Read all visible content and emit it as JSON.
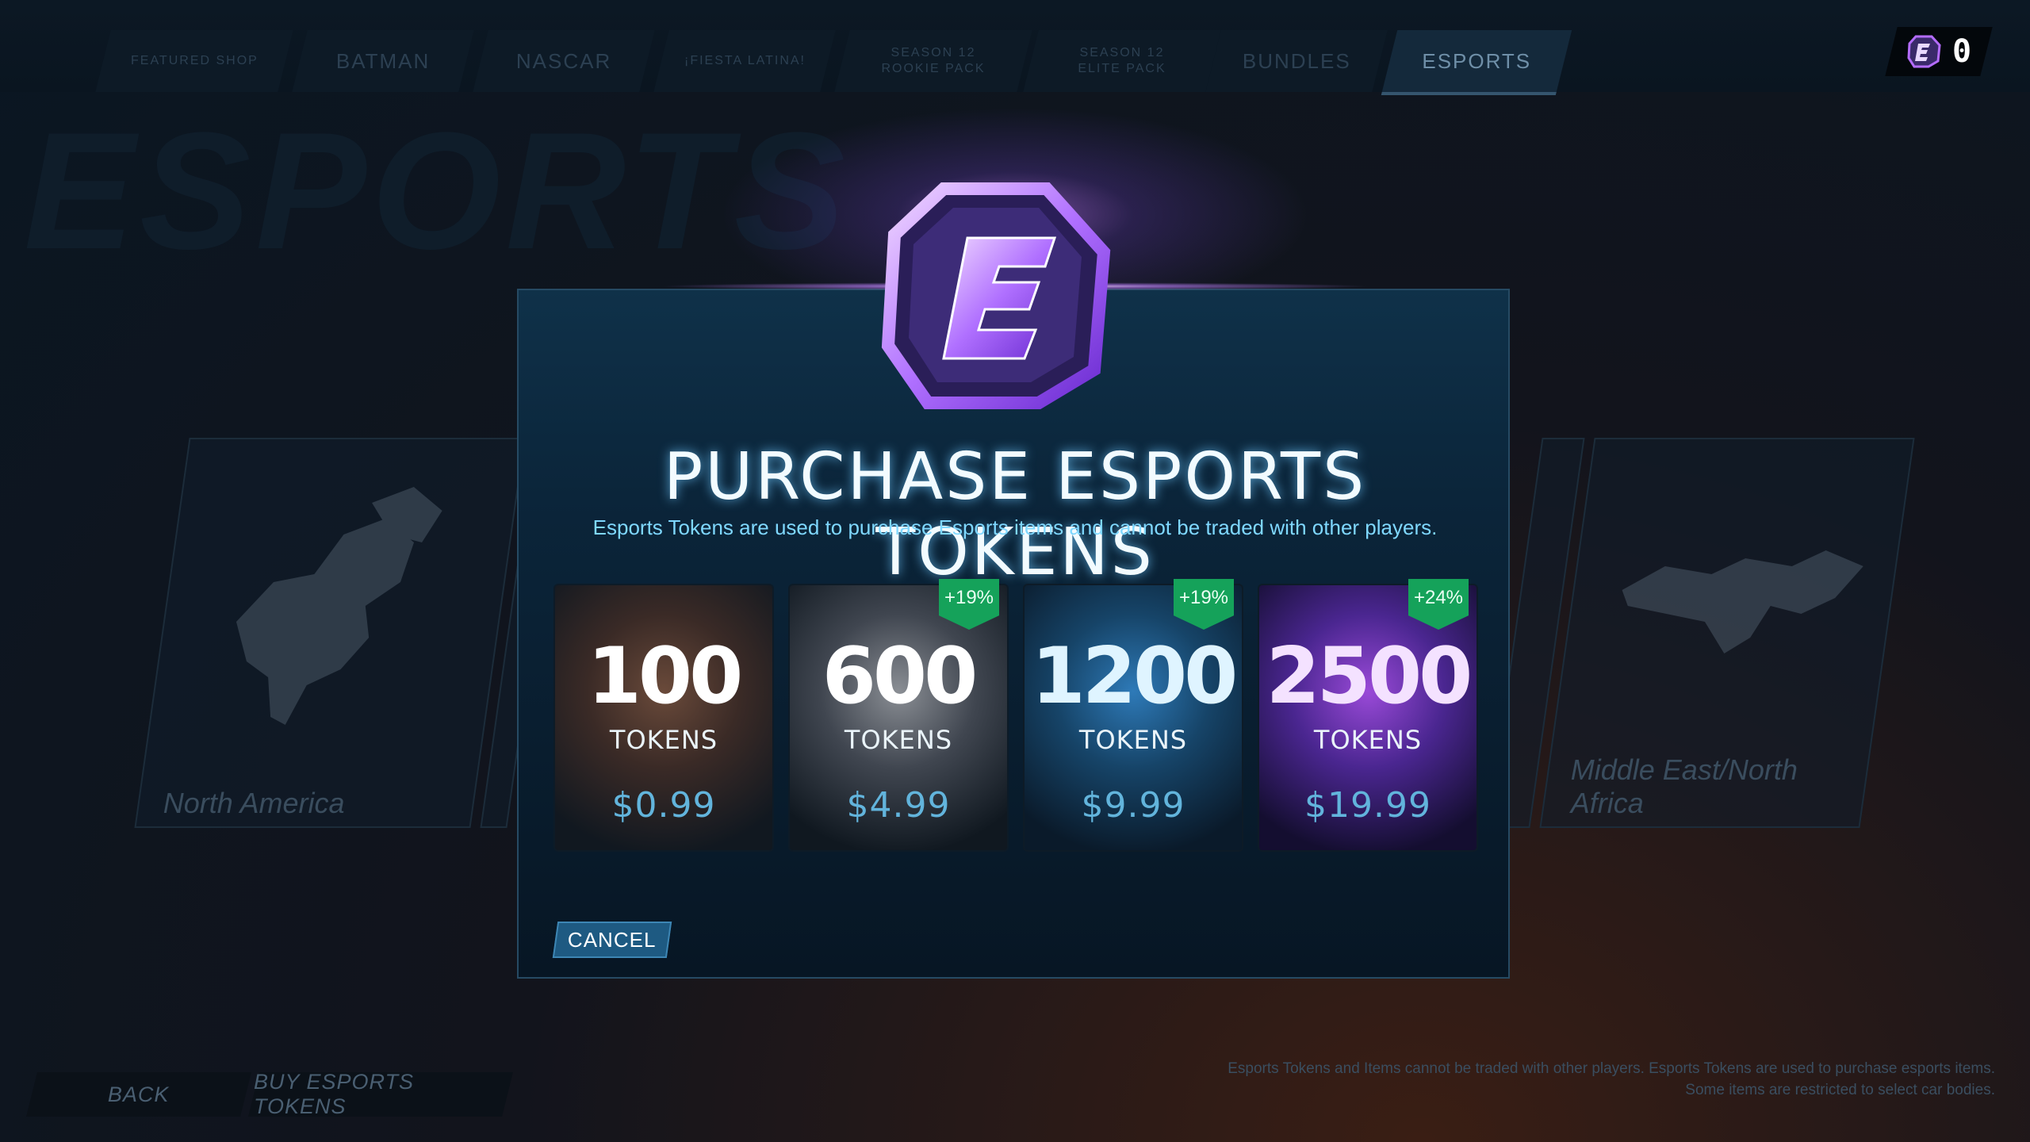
{
  "nav": {
    "tabs": [
      {
        "label": "FEATURED SHOP"
      },
      {
        "label": "BATMAN"
      },
      {
        "label": "NASCAR"
      },
      {
        "label": "¡FIESTA LATINA!"
      },
      {
        "label": "SEASON 12 ROOKIE PACK"
      },
      {
        "label": "SEASON 12 ELITE PACK"
      },
      {
        "label": "BUNDLES"
      },
      {
        "label": "ESPORTS"
      }
    ],
    "active_tab": "ESPORTS",
    "currency_amount": "0"
  },
  "background": {
    "page_title": "ESPORTS",
    "regions": [
      {
        "label": "North America"
      },
      {
        "label": "Middle East/North Africa"
      }
    ]
  },
  "modal": {
    "title": "PURCHASE ESPORTS TOKENS",
    "subtitle": "Esports Tokens are used to purchase Esports items and cannot be traded with other players.",
    "offers": [
      {
        "amount": "100",
        "unit": "TOKENS",
        "price": "$0.99",
        "bonus": ""
      },
      {
        "amount": "600",
        "unit": "TOKENS",
        "price": "$4.99",
        "bonus": "+19%"
      },
      {
        "amount": "1200",
        "unit": "TOKENS",
        "price": "$9.99",
        "bonus": "+19%"
      },
      {
        "amount": "2500",
        "unit": "TOKENS",
        "price": "$19.99",
        "bonus": "+24%"
      }
    ],
    "cancel_label": "CANCEL"
  },
  "bottom": {
    "back_label": "BACK",
    "buy_label": "BUY ESPORTS TOKENS",
    "footnote_line1": "Esports Tokens and Items cannot be traded with other players. Esports Tokens are used to purchase esports items.",
    "footnote_line2": "Some items are restricted to select car bodies."
  },
  "colors": {
    "accent_purple": "#b46cff",
    "badge_green": "#15a25a",
    "price_blue": "#62b4dc"
  }
}
